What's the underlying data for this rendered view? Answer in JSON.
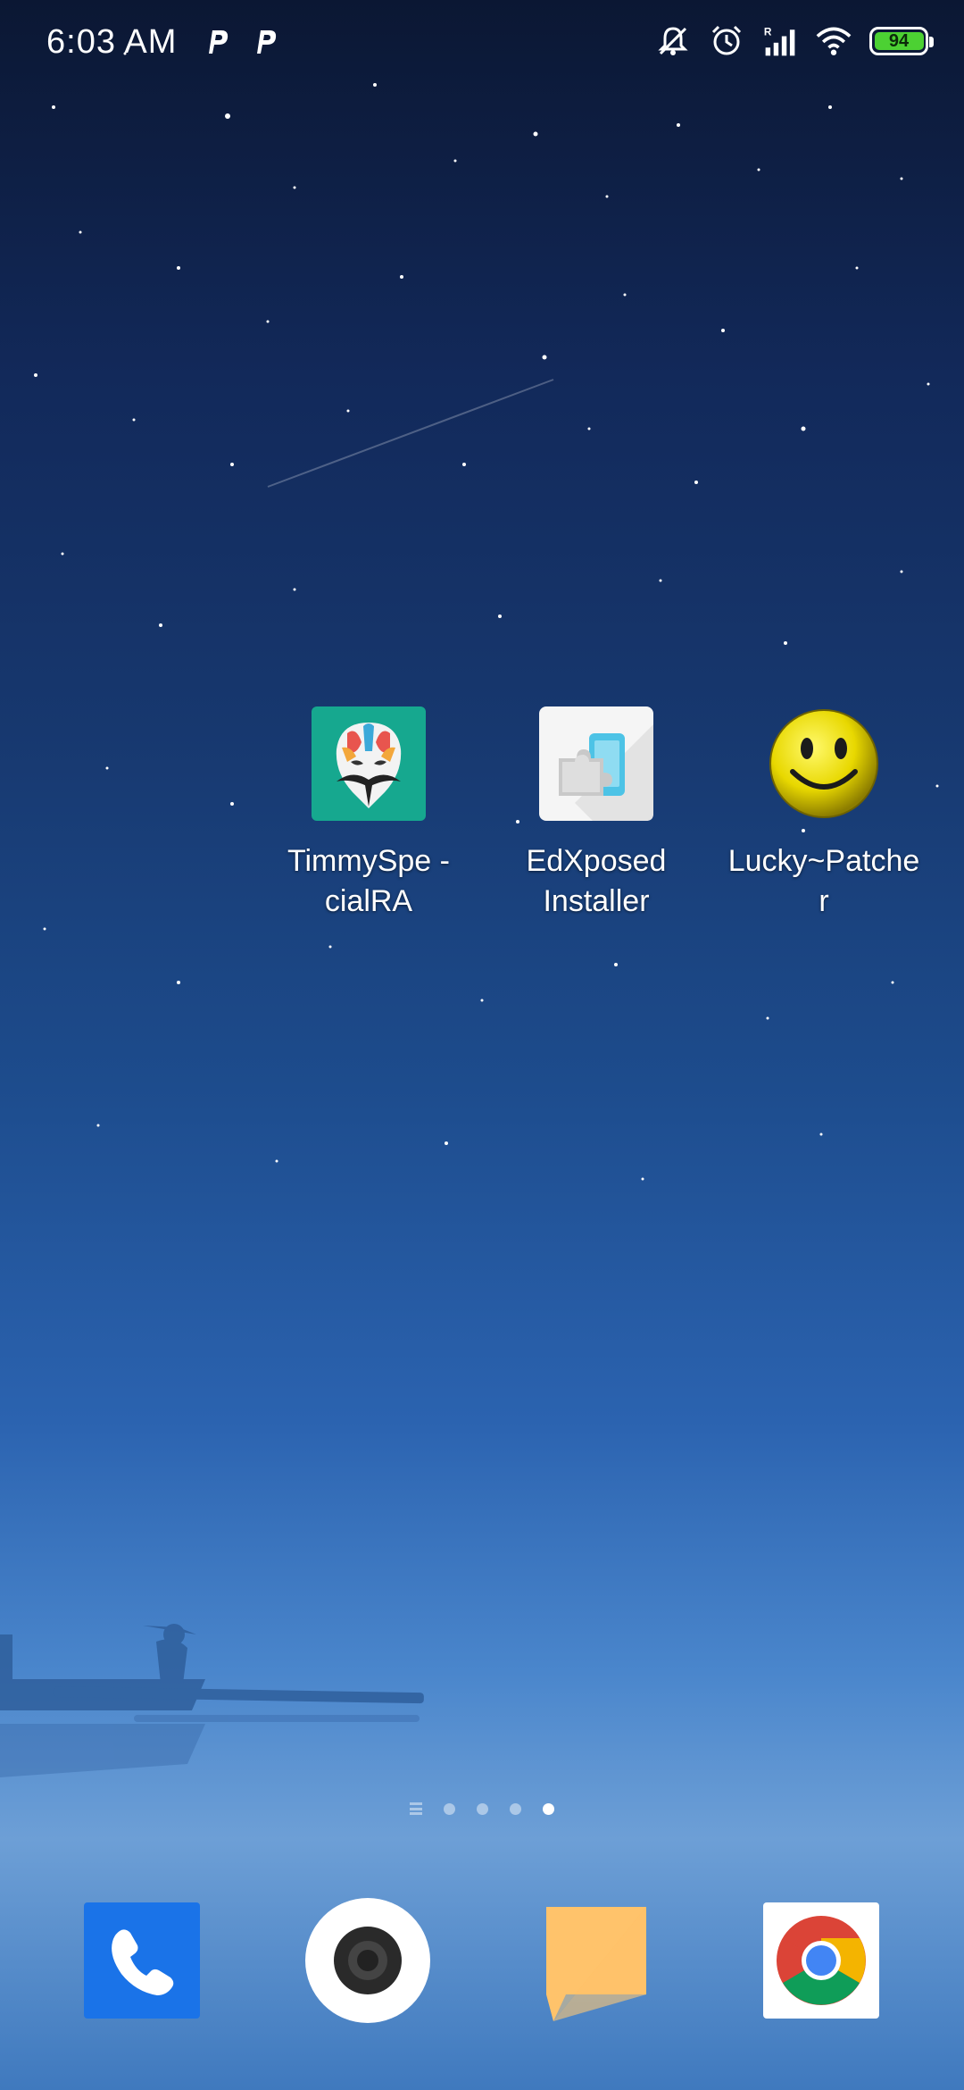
{
  "status_bar": {
    "time": "6:03 AM",
    "battery_level": "94",
    "icons": [
      "p-icon",
      "p-icon",
      "mute-bell-icon",
      "alarm-icon",
      "signal-roaming-icon",
      "wifi-icon",
      "battery-icon"
    ]
  },
  "home": {
    "apps": [
      {
        "label": "TimmySpe -\ncialRA",
        "icon": "magisk-mask-icon"
      },
      {
        "label": "EdXposed\nInstaller",
        "icon": "puzzle-icon"
      },
      {
        "label": "Lucky~Patche\nr",
        "icon": "smiley-icon"
      }
    ]
  },
  "page_indicator": {
    "pages": 4,
    "current": 4
  },
  "dock": {
    "apps": [
      {
        "name": "Phone",
        "icon": "phone-icon"
      },
      {
        "name": "Camera",
        "icon": "camera-icon"
      },
      {
        "name": "Messages",
        "icon": "message-icon"
      },
      {
        "name": "Chrome",
        "icon": "chrome-icon"
      }
    ]
  },
  "colors": {
    "phone_blue": "#1a73e8",
    "magisk_teal": "#16a88f",
    "battery_green": "#4cd133",
    "message_orange": "#ffb95a"
  }
}
